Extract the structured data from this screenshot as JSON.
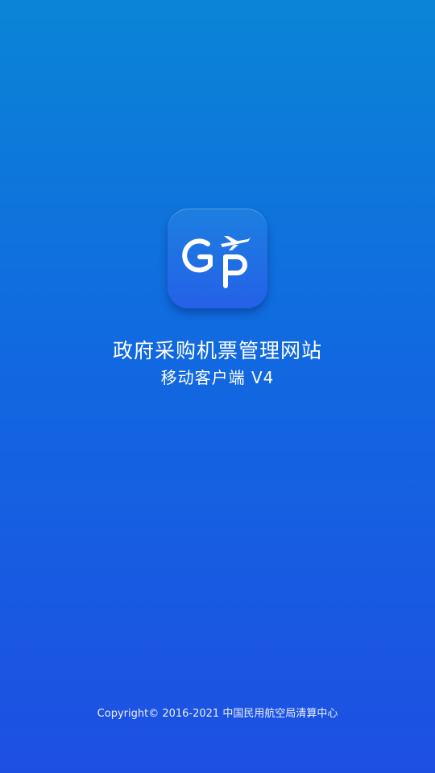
{
  "app": {
    "title": "政府采购机票管理网站",
    "subtitle": "移动客户端 V4",
    "logo_icon": "gp-plane-logo-icon",
    "colors": {
      "bg_top": "#0A85D6",
      "bg_bottom": "#1E4FE3",
      "logo_bg": "#1D7FE0"
    }
  },
  "footer": {
    "copyright": "Copyright© 2016-2021 中国民用航空局清算中心"
  }
}
